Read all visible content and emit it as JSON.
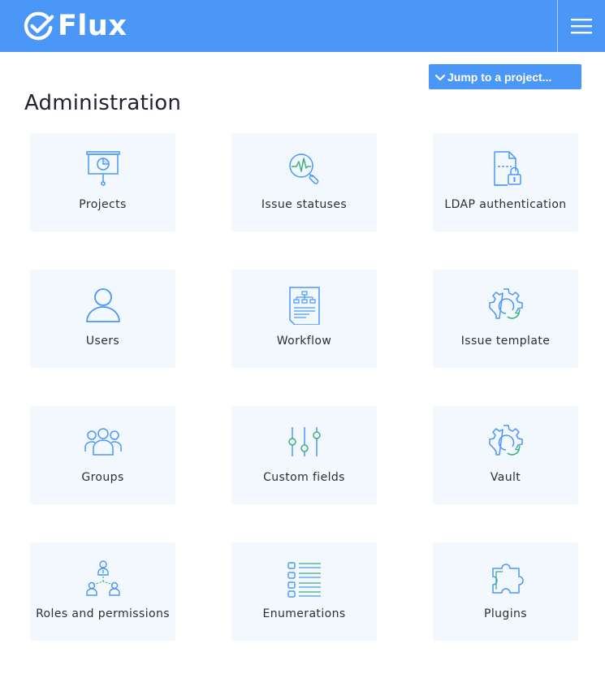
{
  "header": {
    "app_name": "Flux",
    "brand_color": "#4a97f8",
    "logo_icon": "check-circle-icon",
    "menu_icon": "hamburger-menu-icon"
  },
  "jump": {
    "label": "Jump to a project...",
    "icon": "chevron-down-icon"
  },
  "page": {
    "title": "Administration"
  },
  "tiles": [
    {
      "label": "Projects",
      "icon": "presentation-board-icon"
    },
    {
      "label": "Issue statuses",
      "icon": "magnifier-pulse-icon"
    },
    {
      "label": "LDAP authentication",
      "icon": "document-lock-icon"
    },
    {
      "label": "Users",
      "icon": "user-icon"
    },
    {
      "label": "Workflow",
      "icon": "document-flowchart-icon"
    },
    {
      "label": "Issue template",
      "icon": "gear-refresh-icon"
    },
    {
      "label": "Groups",
      "icon": "group-users-icon"
    },
    {
      "label": "Custom fields",
      "icon": "sliders-icon"
    },
    {
      "label": "Vault",
      "icon": "gear-refresh-icon"
    },
    {
      "label": "Roles and permissions",
      "icon": "role-hierarchy-icon"
    },
    {
      "label": "Enumerations",
      "icon": "list-checkbox-icon"
    },
    {
      "label": "Plugins",
      "icon": "puzzle-piece-icon"
    }
  ],
  "colors": {
    "tile_background": "#f3f8fe",
    "icon_blue": "#4a97f8",
    "icon_green": "#3bb07a"
  }
}
